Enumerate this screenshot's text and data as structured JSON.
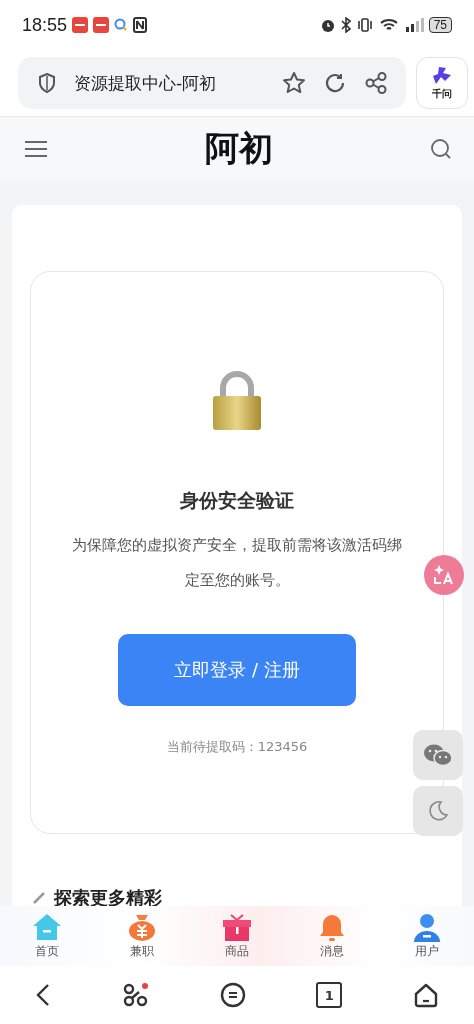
{
  "status_bar": {
    "time": "18:55",
    "battery": "75"
  },
  "browser": {
    "page_title": "资源提取中心-阿初",
    "assistant_label": "千问"
  },
  "site_header": {
    "title": "阿初"
  },
  "verify_card": {
    "title": "身份安全验证",
    "description": "为保障您的虚拟资产安全，提取前需将该激活码绑定至您的账号。",
    "button": "立即登录 / 注册",
    "code_line": "当前待提取码：123456"
  },
  "section_heading": "探索更多精彩",
  "tab_bar": [
    {
      "kind": "home",
      "label": "首页"
    },
    {
      "kind": "money",
      "label": "兼职"
    },
    {
      "kind": "gift",
      "label": "商品"
    },
    {
      "kind": "bell",
      "label": "消息"
    },
    {
      "kind": "user",
      "label": "用户"
    }
  ],
  "system_nav": {
    "tab_count": "1"
  }
}
